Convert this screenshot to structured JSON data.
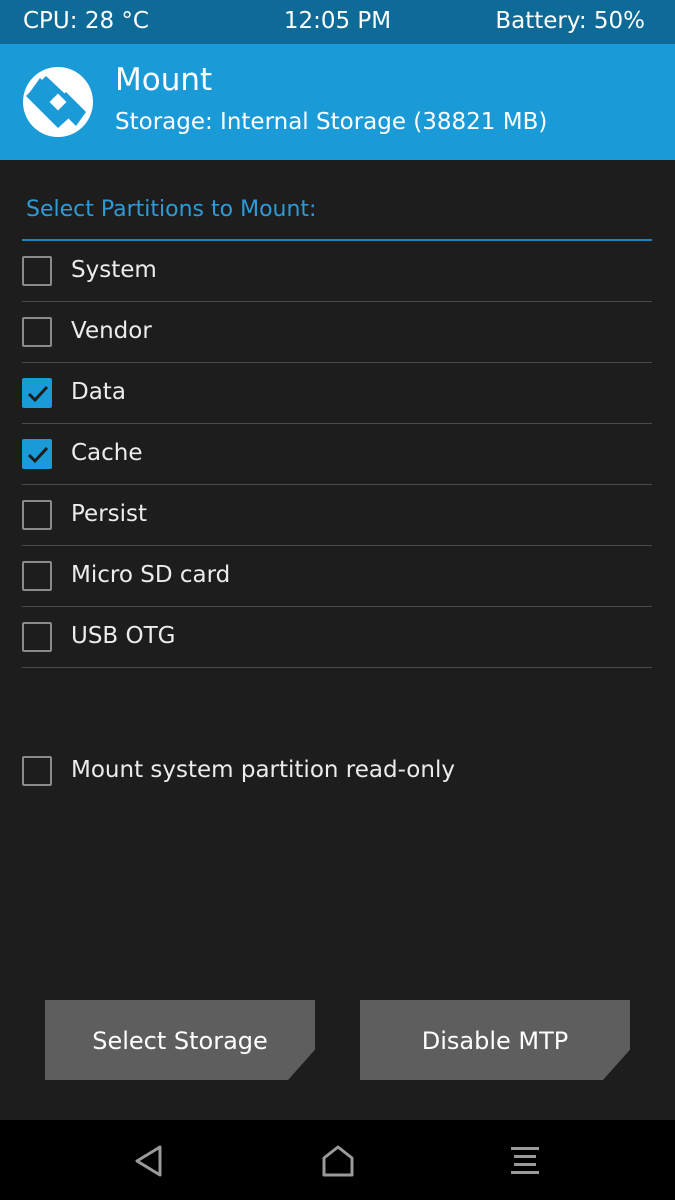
{
  "status_bar": {
    "cpu": "CPU: 28 °C",
    "time": "12:05 PM",
    "battery": "Battery: 50%"
  },
  "header": {
    "title": "Mount",
    "subtitle": "Storage: Internal Storage (38821 MB)",
    "logo_icon": "twrp-logo-icon"
  },
  "section_title": "Select Partitions to Mount:",
  "partitions": [
    {
      "label": "System",
      "checked": false
    },
    {
      "label": "Vendor",
      "checked": false
    },
    {
      "label": "Data",
      "checked": true
    },
    {
      "label": "Cache",
      "checked": true
    },
    {
      "label": "Persist",
      "checked": false
    },
    {
      "label": "Micro SD card",
      "checked": false
    },
    {
      "label": "USB OTG",
      "checked": false
    }
  ],
  "readonly_option": {
    "label": "Mount system partition read-only",
    "checked": false
  },
  "buttons": {
    "select_storage": "Select Storage",
    "disable_mtp": "Disable MTP"
  },
  "nav": {
    "back_icon": "back-triangle-icon",
    "home_icon": "home-icon",
    "menu_icon": "menu-lines-icon"
  },
  "colors": {
    "accent": "#1a9ad7",
    "status_bar": "#0e6a96",
    "background": "#1d1d1d",
    "button": "#5e5e5e"
  }
}
